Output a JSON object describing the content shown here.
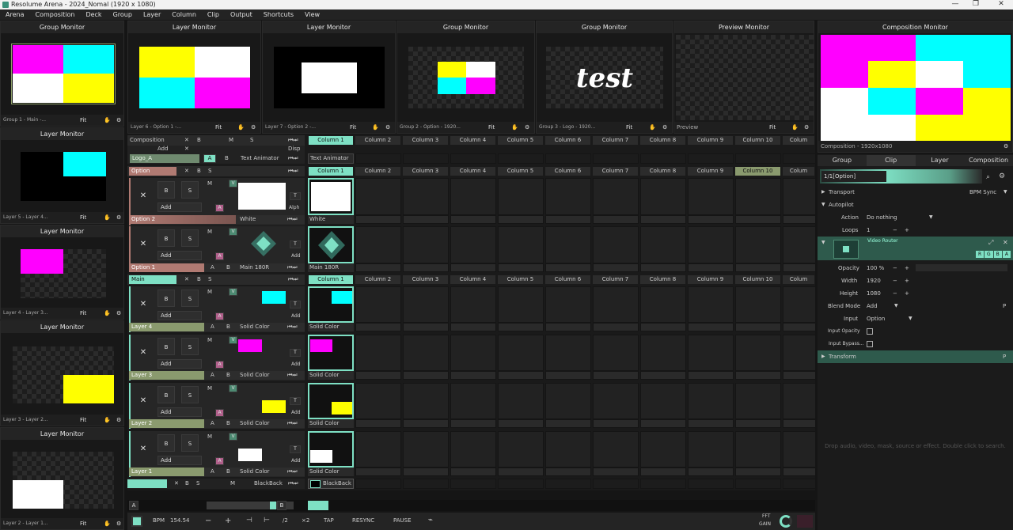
{
  "window": {
    "title": "Resolume Arena - 2024_Nomal (1920 x 1080)",
    "min": "—",
    "max": "❐",
    "close": "✕"
  },
  "menu": [
    "Arena",
    "Composition",
    "Deck",
    "Group",
    "Layer",
    "Column",
    "Clip",
    "Output",
    "Shortcuts",
    "View"
  ],
  "left_monitors": [
    {
      "title": "Group Monitor",
      "footer": "Group 1 - Main -...",
      "fit": "Fit"
    },
    {
      "title": "Layer Monitor",
      "footer": "Layer 5 - Layer 4...",
      "fit": "Fit"
    },
    {
      "title": "Layer Monitor",
      "footer": "Layer 4 - Layer 3...",
      "fit": "Fit"
    },
    {
      "title": "Layer Monitor",
      "footer": "Layer 3 - Layer 2...",
      "fit": "Fit"
    },
    {
      "title": "Layer Monitor",
      "footer": "Layer 2 - Layer 1...",
      "fit": "Fit"
    }
  ],
  "top_monitors": [
    {
      "title": "Layer Monitor",
      "footer": "Layer 6 - Option 1 -...",
      "fit": "Fit"
    },
    {
      "title": "Layer Monitor",
      "footer": "Layer 7 - Option 2 -...",
      "fit": "Fit"
    },
    {
      "title": "Group Monitor",
      "footer": "Group 2 - Option - 1920...",
      "fit": "Fit"
    },
    {
      "title": "Group Monitor",
      "footer": "Group 3 - Logo - 1920...",
      "fit": "Fit",
      "overlay": "test"
    },
    {
      "title": "Preview Monitor",
      "footer": "Preview",
      "fit": "Fit"
    }
  ],
  "composition_monitor": {
    "title": "Composition Monitor",
    "footer": "Composition - 1920x1080"
  },
  "deck": {
    "composition_label": "Composition",
    "add": "Add",
    "columns": [
      "Column 1",
      "Column 2",
      "Column 3",
      "Column 4",
      "Column 5",
      "Column 6",
      "Column 7",
      "Column 8",
      "Column 9",
      "Column 10",
      "Colum"
    ],
    "logo_label": "Logo_A",
    "text_animator": "Text Animator",
    "disp": "Disp",
    "option_group": "Option",
    "option2": "Option 2",
    "option1": "Option 1",
    "main_group": "Main",
    "white": "White",
    "main180r": "Main 180R",
    "layers": [
      "Layer 4",
      "Layer 3",
      "Layer 2",
      "Layer 1"
    ],
    "solid_color": "Solid Color",
    "blackback": "BlackBack",
    "alph": "Alph",
    "btn_b": "B",
    "btn_s": "S",
    "btn_x": "✕",
    "btn_m": "M",
    "btn_v": "V",
    "btn_a": "A",
    "btn_t": "T"
  },
  "transport": {
    "bpm_label": "BPM",
    "bpm": "154.54",
    "minus": "−",
    "plus": "+",
    "div2": "/2",
    "x2": "×2",
    "tap": "TAP",
    "resync": "RESYNC",
    "pause": "PAUSE",
    "fft": "FFT",
    "gain": "GAIN"
  },
  "right_panel": {
    "tabs": [
      "Group",
      "Clip",
      "Layer",
      "Composition"
    ],
    "clip_name": "1/1[Option]",
    "transport_label": "Transport",
    "bpm_sync": "BPM Sync",
    "autopilot": "Autopilot",
    "action_label": "Action",
    "action_value": "Do nothing",
    "loops_label": "Loops",
    "loops_value": "1",
    "video_router": "Video Router",
    "rgba": [
      "R",
      "G",
      "B",
      "A"
    ],
    "opacity_label": "Opacity",
    "opacity_value": "100 %",
    "width_label": "Width",
    "width_value": "1920",
    "height_label": "Height",
    "height_value": "1080",
    "blend_label": "Blend Mode",
    "blend_value": "Add",
    "input_label": "Input",
    "input_value": "Option",
    "input_opacity": "Input Opacity",
    "input_bypass": "Input Bypass...",
    "transform": "Transform",
    "drop_hint": "Drop audio, video, mask, source or effect. Double click to search."
  },
  "colors": {
    "accent": "#7ee0c4",
    "magenta": "#ff00ff",
    "cyan": "#00ffff",
    "yellow": "#ffff00",
    "option_row": "#b07a72",
    "layer_row": "#8a9a6e"
  }
}
